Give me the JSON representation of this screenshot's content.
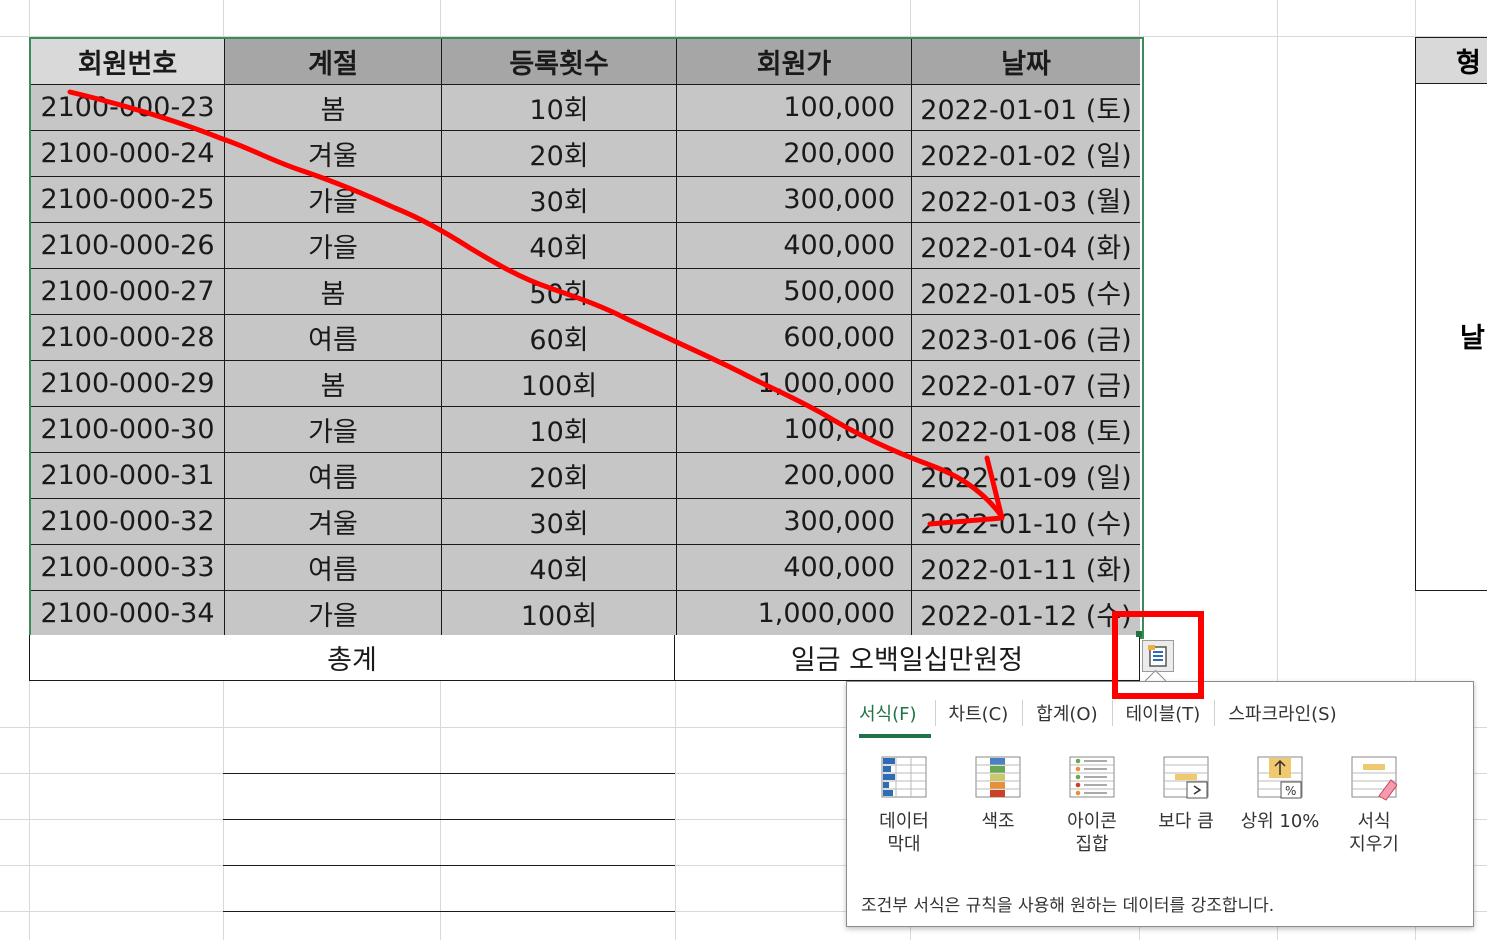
{
  "table": {
    "headers": [
      "회원번호",
      "계절",
      "등록횟수",
      "회원가",
      "날짜"
    ],
    "rows": [
      [
        "2100-000-23",
        "봄",
        "10회",
        "100,000",
        "2022-01-01 (토)"
      ],
      [
        "2100-000-24",
        "겨울",
        "20회",
        "200,000",
        "2022-01-02 (일)"
      ],
      [
        "2100-000-25",
        "가을",
        "30회",
        "300,000",
        "2022-01-03 (월)"
      ],
      [
        "2100-000-26",
        "가을",
        "40회",
        "400,000",
        "2022-01-04 (화)"
      ],
      [
        "2100-000-27",
        "봄",
        "50회",
        "500,000",
        "2022-01-05 (수)"
      ],
      [
        "2100-000-28",
        "여름",
        "60회",
        "600,000",
        "2023-01-06 (금)"
      ],
      [
        "2100-000-29",
        "봄",
        "100회",
        "1,000,000",
        "2022-01-07 (금)"
      ],
      [
        "2100-000-30",
        "가을",
        "10회",
        "100,000",
        "2022-01-08 (토)"
      ],
      [
        "2100-000-31",
        "여름",
        "20회",
        "200,000",
        "2022-01-09 (일)"
      ],
      [
        "2100-000-32",
        "겨울",
        "30회",
        "300,000",
        "2022-01-10 (수)"
      ],
      [
        "2100-000-33",
        "여름",
        "40회",
        "400,000",
        "2022-01-11 (화)"
      ],
      [
        "2100-000-34",
        "가을",
        "100회",
        "1,000,000",
        "2022-01-12 (수)"
      ]
    ],
    "total_label": "총계",
    "total_value": "일금 오백일십만원정"
  },
  "side_table": {
    "header": "형",
    "label": "날"
  },
  "quick_analysis": {
    "button_icon": "quick-analysis-icon",
    "tabs": [
      {
        "label": "서식(F)",
        "active": true
      },
      {
        "label": "차트(C)",
        "active": false
      },
      {
        "label": "합계(O)",
        "active": false
      },
      {
        "label": "테이블(T)",
        "active": false
      },
      {
        "label": "스파크라인(S)",
        "active": false
      }
    ],
    "options": [
      {
        "label": "데이터\n막대",
        "icon": "data-bars-icon"
      },
      {
        "label": "색조",
        "icon": "color-scale-icon"
      },
      {
        "label": "아이콘\n집합",
        "icon": "icon-set-icon"
      },
      {
        "label": "보다 큼",
        "icon": "greater-than-icon"
      },
      {
        "label": "상위 10%",
        "icon": "top-10-percent-icon"
      },
      {
        "label": "서식\n지우기",
        "icon": "clear-format-icon"
      }
    ],
    "footer": "조건부 서식은 규칙을 사용해 원하는 데이터를 강조합니다."
  },
  "colors": {
    "accent": "#217346",
    "annotation": "#ff0000",
    "header_fill": "#a6a6a6",
    "cell_fill": "#c6c6c6"
  }
}
